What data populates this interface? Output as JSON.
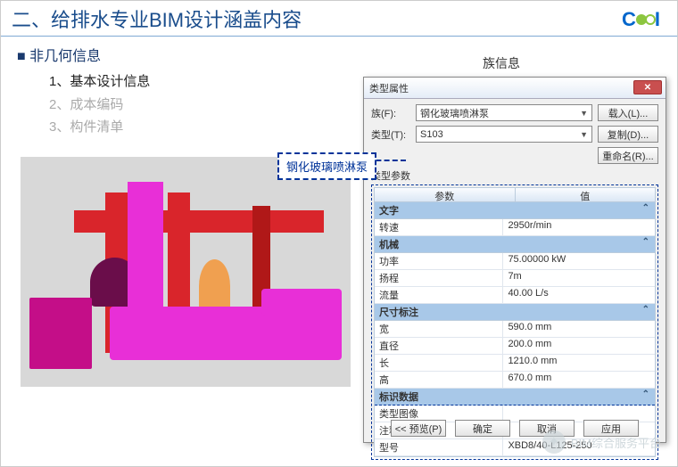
{
  "header": {
    "title": "二、给排水专业BIM设计涵盖内容",
    "logo_left": "C",
    "logo_right": "I"
  },
  "section": {
    "subtitle": "■ 非几何信息",
    "items": [
      {
        "n": "1、",
        "label": "基本设计信息",
        "cls": "active"
      },
      {
        "n": "2、",
        "label": "成本编码",
        "cls": "dim"
      },
      {
        "n": "3、",
        "label": "构件清单",
        "cls": "dim"
      }
    ]
  },
  "family_info_label": "族信息",
  "callout": "钢化玻璃喷淋泵",
  "dialog": {
    "title": "类型属性",
    "close": "✕",
    "family_lbl": "族(F):",
    "family_val": "钢化玻璃喷淋泵",
    "type_lbl": "类型(T):",
    "type_val": "S103",
    "btn_load": "载入(L)...",
    "btn_copy": "复制(D)...",
    "btn_rename": "重命名(R)...",
    "params_lbl": "类型参数",
    "head_param": "参数",
    "head_val": "值",
    "groups": [
      {
        "name": "文字",
        "rows": [
          {
            "k": "转速",
            "v": "2950r/min"
          }
        ]
      },
      {
        "name": "机械",
        "rows": [
          {
            "k": "功率",
            "v": "75.00000 kW"
          },
          {
            "k": "扬程",
            "v": "7m"
          },
          {
            "k": "流量",
            "v": "40.00 L/s"
          }
        ]
      },
      {
        "name": "尺寸标注",
        "rows": [
          {
            "k": "宽",
            "v": "590.0 mm"
          },
          {
            "k": "直径",
            "v": "200.0 mm"
          },
          {
            "k": "长",
            "v": "1210.0 mm"
          },
          {
            "k": "高",
            "v": "670.0 mm"
          }
        ]
      },
      {
        "name": "标识数据",
        "rows": [
          {
            "k": "类型图像",
            "v": ""
          },
          {
            "k": "注释记号",
            "v": ""
          },
          {
            "k": "型号",
            "v": "XBD8/40-L125-250"
          }
        ]
      }
    ],
    "foot": {
      "preview": "<< 预览(P)",
      "ok": "确定",
      "cancel": "取消",
      "apply": "应用"
    }
  },
  "watermark": "BIM综合服务平台"
}
